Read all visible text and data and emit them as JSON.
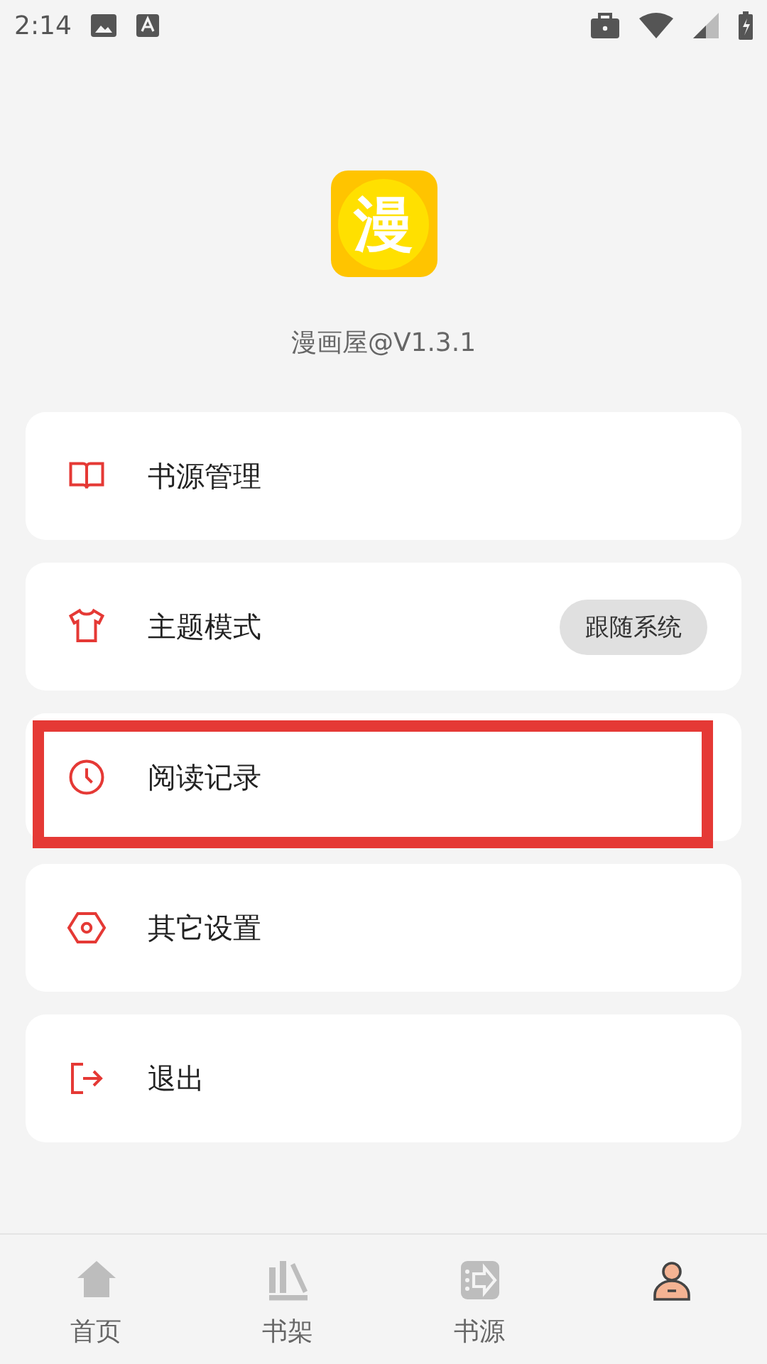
{
  "status_bar": {
    "time": "2:14"
  },
  "app": {
    "logo_text": "漫",
    "version": "漫画屋@V1.3.1"
  },
  "menu": [
    {
      "kind": "book",
      "label": "书源管理",
      "highlighted": false
    },
    {
      "kind": "shirt",
      "label": "主题模式",
      "value": "跟随系统",
      "highlighted": false
    },
    {
      "kind": "clock",
      "label": "阅读记录",
      "highlighted": true
    },
    {
      "kind": "hexagon",
      "label": "其它设置",
      "highlighted": false
    },
    {
      "kind": "exit",
      "label": "退出",
      "highlighted": false
    }
  ],
  "nav": [
    {
      "kind": "home",
      "label": "首页",
      "selected": false
    },
    {
      "kind": "shelf",
      "label": "书架",
      "selected": false
    },
    {
      "kind": "source",
      "label": "书源",
      "selected": false
    },
    {
      "kind": "user",
      "selected": true
    }
  ]
}
